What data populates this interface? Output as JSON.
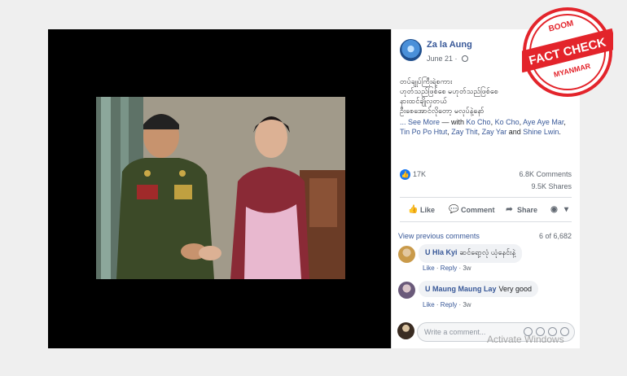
{
  "post": {
    "author": "Za la Aung",
    "date": "June 21 ·",
    "text_lines": [
      "တပ်ချုပ်ကြီးရဲ့စကား",
      "ဟုတ်သည်ဖြစ်စေ မဟုတ်သည်ဖြစ်စေ",
      "နားထင်ချိုလှတယ်",
      "ဦးစေအောင်လိုတော့ မလုပ်နဲ့နော်"
    ],
    "see_more": "... See More",
    "with_prefix": " — with ",
    "tagged": [
      "Ko Cho",
      "Ko Cho",
      "Aye Aye Mar",
      "Tin Po Po Htut",
      "Zay Thit",
      "Zay Yar",
      "Shine Lwin"
    ],
    "sep": ", ",
    "and": " and ",
    "end": "."
  },
  "stats": {
    "likes": "17K",
    "comments": "6.8K Comments",
    "shares": "9.5K Shares"
  },
  "actions": {
    "like": "Like",
    "comment": "Comment",
    "share": "Share"
  },
  "comments_section": {
    "view_previous": "View previous comments",
    "count": "6 of 6,682",
    "items": [
      {
        "name": "U Hla Kyi",
        "text": "ဆင်ရော့လုံ ယုံနေင်းနဲ့",
        "like": "Like",
        "reply": "Reply",
        "time": "3w"
      },
      {
        "name": "U Maung Maung Lay",
        "text": "Very good",
        "like": "Like",
        "reply": "Reply",
        "time": "3w"
      }
    ],
    "placeholder": "Write a comment..."
  },
  "stamp": {
    "top": "BOOM",
    "main": "FACT CHECK",
    "bottom": "MYANMAR",
    "color": "#e3242b"
  },
  "watermark": "Activate Windows",
  "icons": [
    "globe-icon",
    "like-icon",
    "comment-icon",
    "share-icon",
    "emoji-icon",
    "camera-icon",
    "gif-icon",
    "sticker-icon"
  ]
}
